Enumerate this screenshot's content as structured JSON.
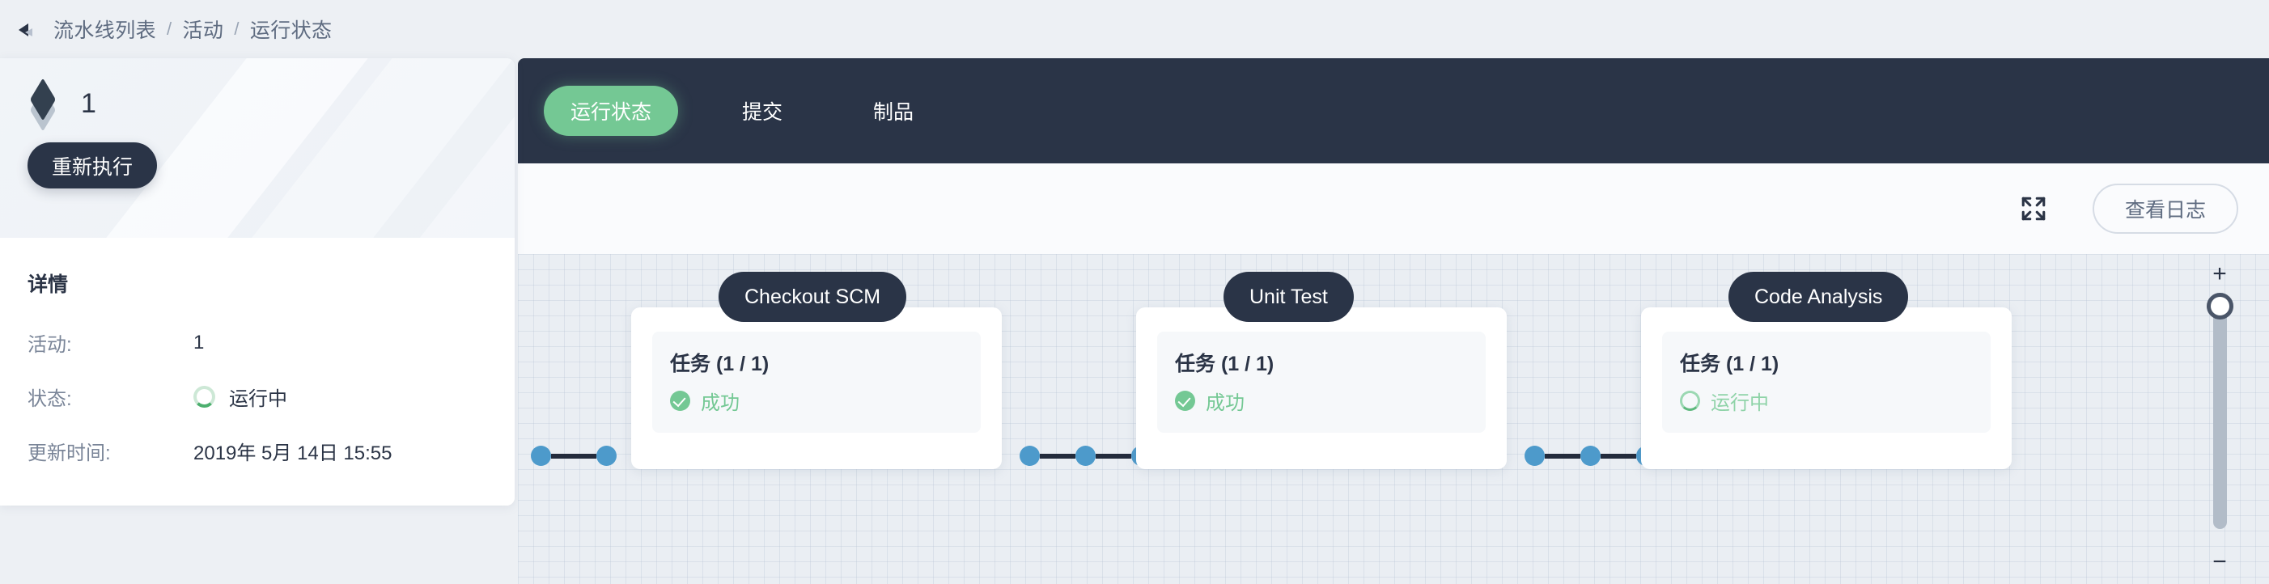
{
  "breadcrumb": {
    "back_icon": "back-arrow-icon",
    "items": [
      "流水线列表",
      "活动",
      "运行状态"
    ],
    "separator": "/"
  },
  "sidebar": {
    "icon": "layers-icon",
    "title": "1",
    "rerun_label": "重新执行",
    "details_heading": "详情",
    "rows": [
      {
        "label": "活动:",
        "value": "1",
        "icon": ""
      },
      {
        "label": "状态:",
        "value": "运行中",
        "icon": "running-spinner-icon"
      },
      {
        "label": "更新时间:",
        "value": "2019年 5月 14日 15:55",
        "icon": ""
      }
    ]
  },
  "tabs": [
    {
      "label": "运行状态",
      "active": true
    },
    {
      "label": "提交",
      "active": false
    },
    {
      "label": "制品",
      "active": false
    }
  ],
  "toolbar": {
    "expand_icon": "expand-fullscreen-icon",
    "view_log_label": "查看日志"
  },
  "zoom_control": {
    "plus_label": "+",
    "minus_label": "−",
    "handle_position_percent": 8
  },
  "pipeline": {
    "stages": [
      {
        "label": "Checkout SCM",
        "job_title": "任务 (1 / 1)",
        "status_text": "成功",
        "status_kind": "success",
        "status_icon": "check-circle-icon"
      },
      {
        "label": "Unit Test",
        "job_title": "任务 (1 / 1)",
        "status_text": "成功",
        "status_kind": "success",
        "status_icon": "check-circle-icon"
      },
      {
        "label": "Code Analysis",
        "job_title": "任务 (1 / 1)",
        "status_text": "运行中",
        "status_kind": "running",
        "status_icon": "running-spinner-icon"
      }
    ]
  },
  "colors": {
    "accent_green": "#74C894",
    "dark_navy": "#2A3447",
    "connector_blue": "#4D9ACB",
    "canvas_bg": "#EAEEF3",
    "page_bg": "#EDF0F4"
  }
}
